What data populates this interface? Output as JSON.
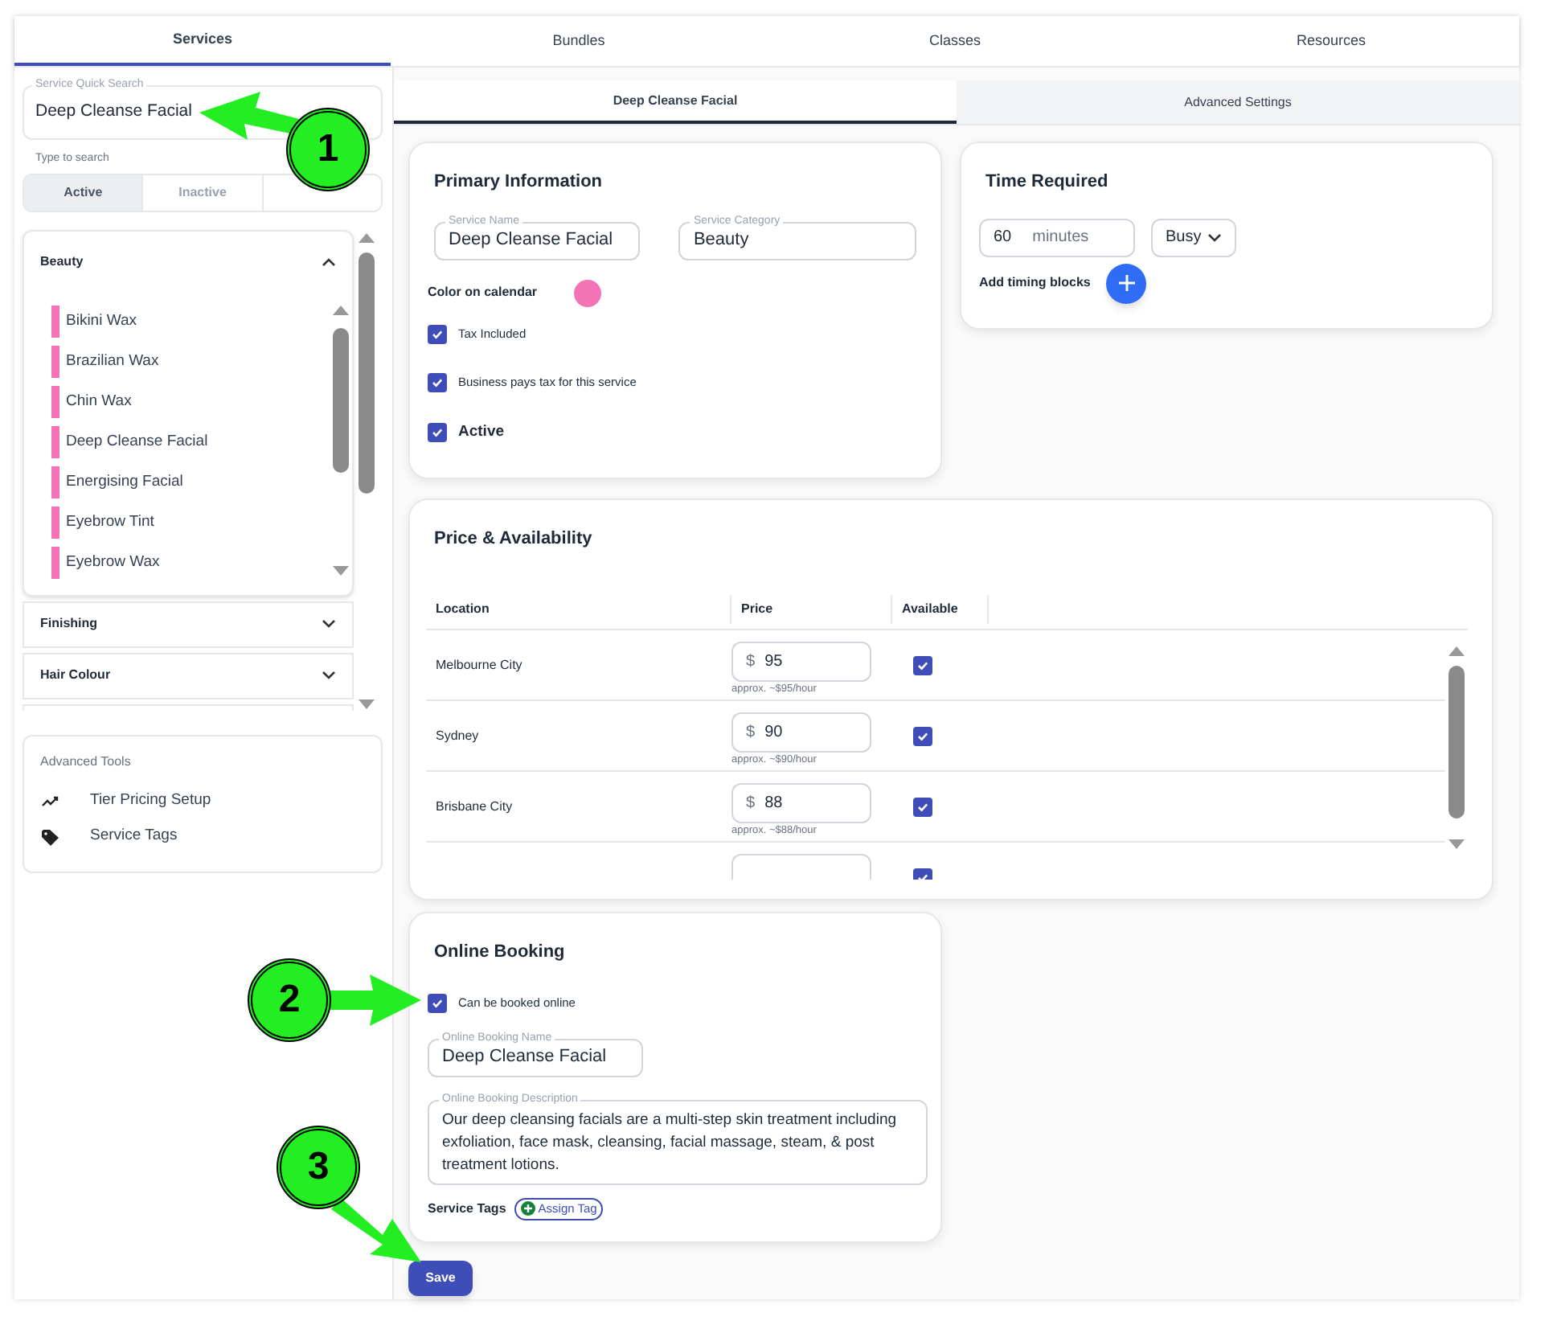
{
  "top_tabs": [
    {
      "label": "Services",
      "selected": true
    },
    {
      "label": "Bundles",
      "selected": false
    },
    {
      "label": "Classes",
      "selected": false
    },
    {
      "label": "Resources",
      "selected": false
    }
  ],
  "sidebar": {
    "search": {
      "label": "Service Quick Search",
      "value": "Deep Cleanse Facial",
      "hint": "Type to search"
    },
    "filter_tabs": [
      {
        "label": "Active",
        "selected": true
      },
      {
        "label": "Inactive",
        "selected": false
      }
    ],
    "categories": [
      {
        "name": "Beauty",
        "expanded": true,
        "services": [
          {
            "name": "Bikini Wax",
            "color": "#f472b6"
          },
          {
            "name": "Brazilian Wax",
            "color": "#f472b6"
          },
          {
            "name": "Chin Wax",
            "color": "#f472b6"
          },
          {
            "name": "Deep Cleanse Facial",
            "color": "#f472b6"
          },
          {
            "name": "Energising Facial",
            "color": "#f472b6"
          },
          {
            "name": "Eyebrow Tint",
            "color": "#f472b6"
          },
          {
            "name": "Eyebrow Wax",
            "color": "#f472b6"
          }
        ]
      },
      {
        "name": "Finishing",
        "expanded": false
      },
      {
        "name": "Hair Colour",
        "expanded": false
      }
    ],
    "advanced_tools": {
      "title": "Advanced Tools",
      "items": [
        {
          "label": "Tier Pricing Setup",
          "kind": "trend"
        },
        {
          "label": "Service Tags",
          "kind": "tag"
        }
      ]
    }
  },
  "sub_tabs": [
    {
      "label": "Deep Cleanse Facial",
      "selected": true
    },
    {
      "label": "Advanced Settings",
      "selected": false
    }
  ],
  "primary": {
    "title": "Primary Information",
    "fields": [
      {
        "label": "Service Name",
        "value": "Deep Cleanse Facial"
      },
      {
        "label": "Service Category",
        "value": "Beauty"
      }
    ],
    "color_label": "Color on calendar",
    "color": "#f472b6",
    "checks": [
      {
        "label": "Tax Included",
        "checked": true,
        "kind": "normal"
      },
      {
        "label": "Business pays tax for this service",
        "checked": true,
        "kind": "normal"
      },
      {
        "label": "Active",
        "checked": true,
        "kind": "strong"
      }
    ]
  },
  "time": {
    "title": "Time Required",
    "value": "60",
    "unit": "minutes",
    "status": "Busy",
    "add_label": "Add timing blocks"
  },
  "price": {
    "title": "Price & Availability",
    "columns": [
      "Location",
      "Price",
      "Available"
    ],
    "rows": [
      {
        "location": "Melbourne City",
        "currency": "$",
        "price": "95",
        "hint": "approx. ~$95/hour",
        "available": true
      },
      {
        "location": "Sydney",
        "currency": "$",
        "price": "90",
        "hint": "approx. ~$90/hour",
        "available": true
      },
      {
        "location": "Brisbane City",
        "currency": "$",
        "price": "88",
        "hint": "approx. ~$88/hour",
        "available": true
      },
      {
        "available": true
      }
    ]
  },
  "online": {
    "title": "Online Booking",
    "check": {
      "label": "Can be booked online",
      "checked": true
    },
    "name": {
      "label": "Online Booking Name",
      "value": "Deep Cleanse Facial"
    },
    "description": {
      "label": "Online Booking Description",
      "value": "Our deep cleansing facials are a multi-step skin treatment including exfoliation, face mask, cleansing, facial massage, steam, & post treatment lotions."
    },
    "tags_label": "Service Tags",
    "assign_label": "Assign Tag"
  },
  "save": "Save",
  "callouts": [
    {
      "label": "1"
    },
    {
      "label": "2"
    },
    {
      "label": "3"
    }
  ]
}
